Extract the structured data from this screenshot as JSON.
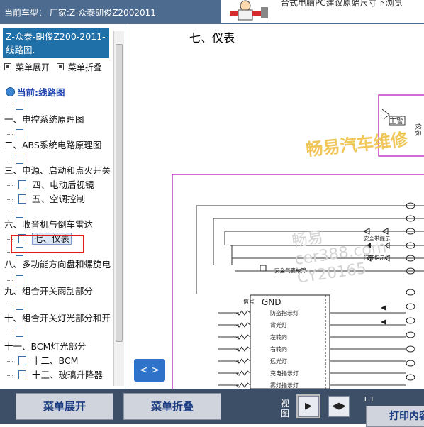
{
  "topbar": {
    "vehicle_text": "当前车型： 厂家:Z-众泰朗俊Z2002011",
    "banner_text": "台式电脑PC建议原始尺寸下浏览"
  },
  "sidebar": {
    "title": "Z-众泰-朗俊Z200-2011- 线路图.",
    "expand_toggle": "菜单展开",
    "collapse_toggle": "菜单折叠",
    "current": "当前:线路图",
    "items": [
      {
        "label": "",
        "type": "doc"
      },
      {
        "label": "一、电控系统原理图",
        "type": "folder"
      },
      {
        "label": "",
        "type": "doc"
      },
      {
        "label": "二、ABS系统电路原理图",
        "type": "folder"
      },
      {
        "label": "",
        "type": "doc"
      },
      {
        "label": "三、电源、启动和点火开关",
        "type": "folder"
      },
      {
        "label": "四、电动后视镜",
        "type": "doc"
      },
      {
        "label": "五、空调控制",
        "type": "doc"
      },
      {
        "label": "",
        "type": "doc"
      },
      {
        "label": "六、收音机与倒车雷达",
        "type": "folder"
      },
      {
        "label": "七、仪表",
        "type": "doc",
        "selected": true
      },
      {
        "label": "",
        "type": "doc"
      },
      {
        "label": "八、多功能方向盘和螺旋电",
        "type": "folder"
      },
      {
        "label": "",
        "type": "doc"
      },
      {
        "label": "九、组合开关雨刮部分",
        "type": "folder"
      },
      {
        "label": "",
        "type": "doc"
      },
      {
        "label": "十、组合开关灯光部分和开",
        "type": "folder"
      },
      {
        "label": "",
        "type": "doc"
      },
      {
        "label": "十一、BCM灯光部分",
        "type": "folder"
      },
      {
        "label": "十二、BCM",
        "type": "doc"
      },
      {
        "label": "十三、玻璃升降器",
        "type": "doc"
      }
    ]
  },
  "content": {
    "section_title": "七、仪表",
    "watermark_brand": "畅易汽车维修",
    "watermark_lines": [
      "畅易",
      "cer388.com",
      "CY20165"
    ],
    "nav_label": "< >",
    "diagram_labels": [
      "信号",
      "GND",
      "防盗指示灯",
      "背光灯",
      "左转向",
      "右转向",
      "远光灯",
      "充电指示灯",
      "雾灯指示灯",
      "钥匙提醒",
      "安全气囊故障",
      "安全带提示",
      "门开指示灯",
      "主警",
      "仪表"
    ]
  },
  "bottombar": {
    "expand_button": "菜单展开",
    "collapse_button": "菜单折叠",
    "view_label": "视图",
    "view_btn1": "▶",
    "view_btn2": "◀▶",
    "page_num": "1.1",
    "print_button": "打印内容"
  }
}
